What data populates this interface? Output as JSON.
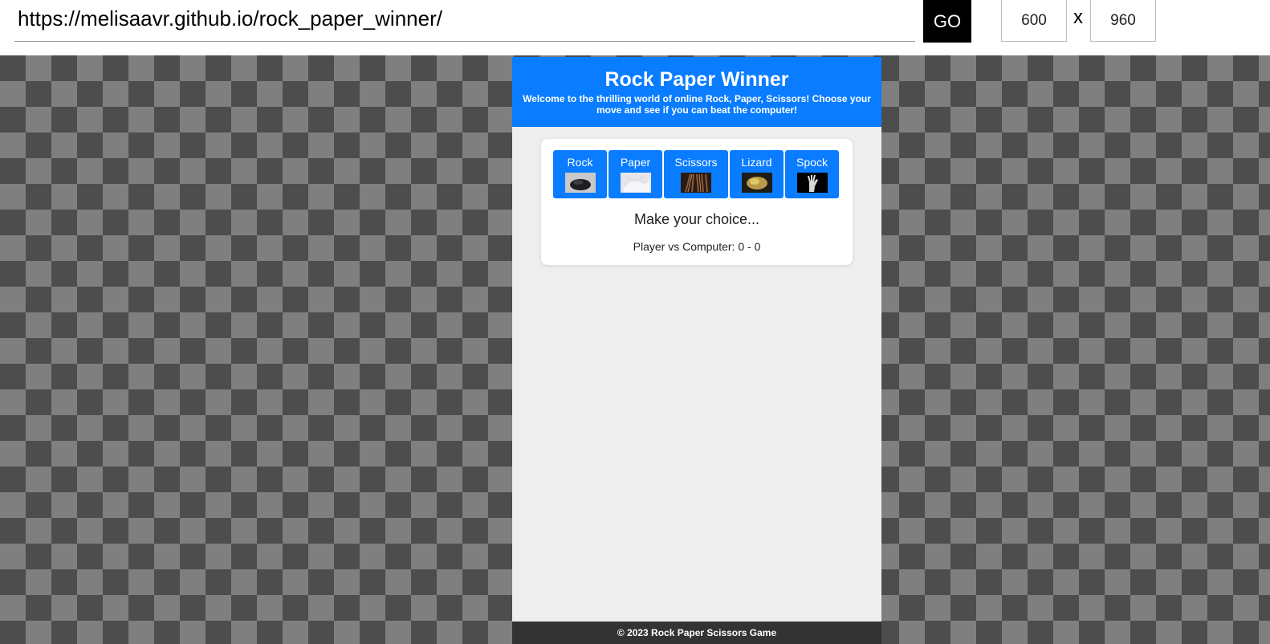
{
  "toolbar": {
    "url": "https://melisaavr.github.io/rock_paper_winner/",
    "go_label": "GO",
    "width": "600",
    "times": "x",
    "height": "960"
  },
  "page": {
    "title": "Rock Paper Winner",
    "subtitle": "Welcome to the thrilling world of online Rock, Paper, Scissors! Choose your move and see if you can beat the computer!",
    "choices": [
      {
        "label": "Rock",
        "icon": "rock-image"
      },
      {
        "label": "Paper",
        "icon": "paper-image"
      },
      {
        "label": "Scissors",
        "icon": "scissors-image"
      },
      {
        "label": "Lizard",
        "icon": "lizard-image"
      },
      {
        "label": "Spock",
        "icon": "spock-hand-image"
      }
    ],
    "status": "Make your choice...",
    "score": "Player vs Computer: 0 - 0",
    "footer": "© 2023 Rock Paper Scissors Game"
  },
  "colors": {
    "accent": "#0a7cff",
    "page_bg": "#eeeeee",
    "footer_bg": "#333333"
  }
}
